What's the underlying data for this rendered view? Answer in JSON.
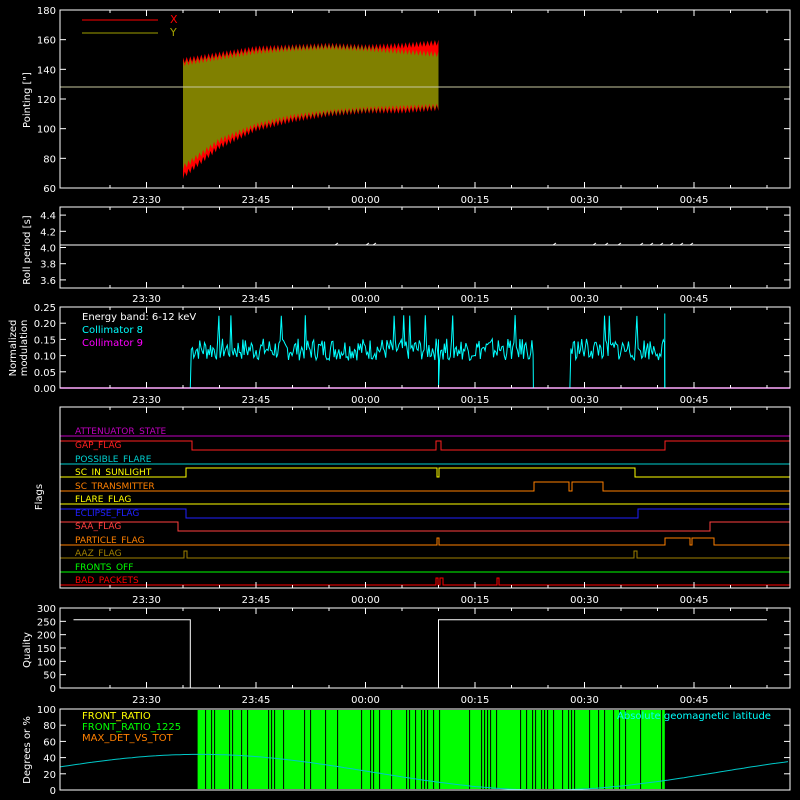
{
  "x_ticks": [
    "23:30",
    "23:45",
    "00:00",
    "00:15",
    "00:30",
    "00:45"
  ],
  "colors": {
    "background": "#000000",
    "axes": "#ffffff",
    "x_series": "#ff0000",
    "y_series": "#808000",
    "collimator8": "#00ffff",
    "collimator9": "#ff00ff",
    "front_ratio": "#ffff00",
    "front_ratio_1225": "#00ff00",
    "max_det": "#ff8000",
    "latitude": "#00c8c8"
  },
  "chart_data": [
    {
      "type": "area",
      "ylabel": "Pointing [\"]",
      "ylim": [
        60,
        180
      ],
      "yticks": [
        "60",
        "80",
        "100",
        "120",
        "140",
        "160",
        "180"
      ],
      "legend_position": "top-left",
      "series": [
        {
          "name": "X",
          "x": [
            "23:35",
            "23:40",
            "23:45",
            "23:50",
            "23:55",
            "00:00",
            "00:05",
            "00:10"
          ],
          "upper": [
            148,
            152,
            156,
            157,
            158,
            157,
            158,
            160
          ],
          "lower": [
            66,
            86,
            98,
            104,
            108,
            110,
            110,
            112
          ]
        },
        {
          "name": "Y",
          "x": [
            "23:35",
            "23:40",
            "23:45",
            "23:50",
            "23:55",
            "00:00",
            "00:05",
            "00:10"
          ],
          "upper": [
            146,
            150,
            154,
            156,
            157,
            156,
            154,
            152
          ],
          "lower": [
            72,
            90,
            100,
            106,
            109,
            111,
            112,
            113
          ]
        }
      ],
      "reference_line": 128
    },
    {
      "type": "line",
      "ylabel": "Roll period [s]",
      "ylim": [
        3.5,
        4.5
      ],
      "yticks": [
        "3.6",
        "3.8",
        "4.0",
        "4.2",
        "4.4"
      ],
      "series": [
        {
          "x": [
            "23:20",
            "00:55"
          ],
          "values": [
            4.04,
            4.04
          ]
        }
      ]
    },
    {
      "type": "line",
      "ylabel": "Normalized modulation",
      "ylim": [
        0,
        0.25
      ],
      "yticks": [
        "0.00",
        "0.05",
        "0.10",
        "0.15",
        "0.20",
        "0.25"
      ],
      "annotation": "Energy band: 6-12 keV",
      "legend_position": "top-left",
      "series": [
        {
          "name": "Collimator 8",
          "segments": [
            [
              "23:36",
              "00:10"
            ],
            [
              "00:10",
              "00:23"
            ],
            [
              "00:28",
              "00:41"
            ]
          ],
          "level": 0.12
        },
        {
          "name": "Collimator 9",
          "values": [
            0,
            0
          ]
        }
      ]
    },
    {
      "type": "line",
      "ylabel": "Flags",
      "flags": [
        {
          "name": "ATTENUATOR_STATE",
          "color": "#c000c0"
        },
        {
          "name": "GAP_FLAG",
          "color": "#ff2020"
        },
        {
          "name": "POSSIBLE_FLARE",
          "color": "#00d0d0"
        },
        {
          "name": "SC_IN_SUNLIGHT",
          "color": "#ffff00"
        },
        {
          "name": "SC_TRANSMITTER",
          "color": "#ff8000"
        },
        {
          "name": "FLARE_FLAG",
          "color": "#ffff00"
        },
        {
          "name": "ECLIPSE_FLAG",
          "color": "#2020ff"
        },
        {
          "name": "SAA_FLAG",
          "color": "#ff4040"
        },
        {
          "name": "PARTICLE_FLAG",
          "color": "#ff8000"
        },
        {
          "name": "AAZ_FLAG",
          "color": "#a08000"
        },
        {
          "name": "FRONTS_OFF",
          "color": "#00ff00"
        },
        {
          "name": "BAD_PACKETS",
          "color": "#ff0000"
        }
      ]
    },
    {
      "type": "line",
      "ylabel": "Quality",
      "ylim": [
        0,
        300
      ],
      "yticks": [
        "0",
        "50",
        "100",
        "150",
        "200",
        "250",
        "300"
      ],
      "series": [
        {
          "x": [
            "23:20",
            "23:36",
            "23:36",
            "00:10",
            "00:10",
            "00:55"
          ],
          "values": [
            256,
            256,
            0,
            0,
            256,
            256
          ]
        }
      ]
    },
    {
      "type": "bar",
      "ylabel": "Degrees or %",
      "ylim": [
        0,
        100
      ],
      "yticks": [
        "0",
        "20",
        "40",
        "60",
        "80",
        "100"
      ],
      "legend_position": "top-left",
      "annotation": "Absolute geomagnetic latitude",
      "series": [
        {
          "name": "FRONT_RATIO"
        },
        {
          "name": "FRONT_RATIO_1225",
          "range": [
            "23:37",
            "00:41"
          ],
          "values": [
            100
          ]
        },
        {
          "name": "MAX_DET_VS_TOT"
        }
      ]
    }
  ]
}
